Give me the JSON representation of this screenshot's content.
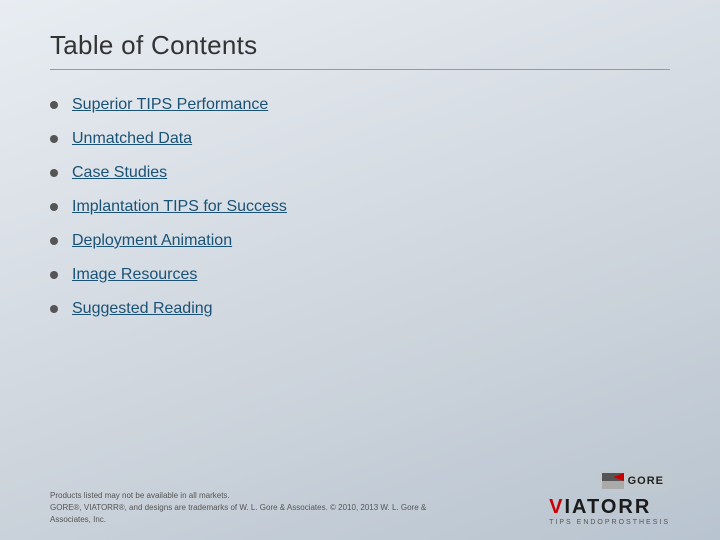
{
  "slide": {
    "title": "Table of Contents",
    "toc_items": [
      {
        "label": "Superior TIPS Performance"
      },
      {
        "label": "Unmatched Data"
      },
      {
        "label": "Case Studies"
      },
      {
        "label": "Implantation TIPS for Success"
      },
      {
        "label": "Deployment Animation"
      },
      {
        "label": "Image Resources"
      },
      {
        "label": "Suggested Reading"
      }
    ],
    "footer": {
      "line1": "Products listed may not be available in all markets.",
      "line2": "GORE®, VIATORR®, and designs are trademarks of W. L. Gore & Associates. © 2010, 2013 W. L. Gore & Associates, Inc."
    },
    "logo": {
      "gore_label": "GORE",
      "viatorr_label": "VIATORR",
      "viatorr_subtitle": "TIPS ENDOPROSTHESIS"
    }
  }
}
